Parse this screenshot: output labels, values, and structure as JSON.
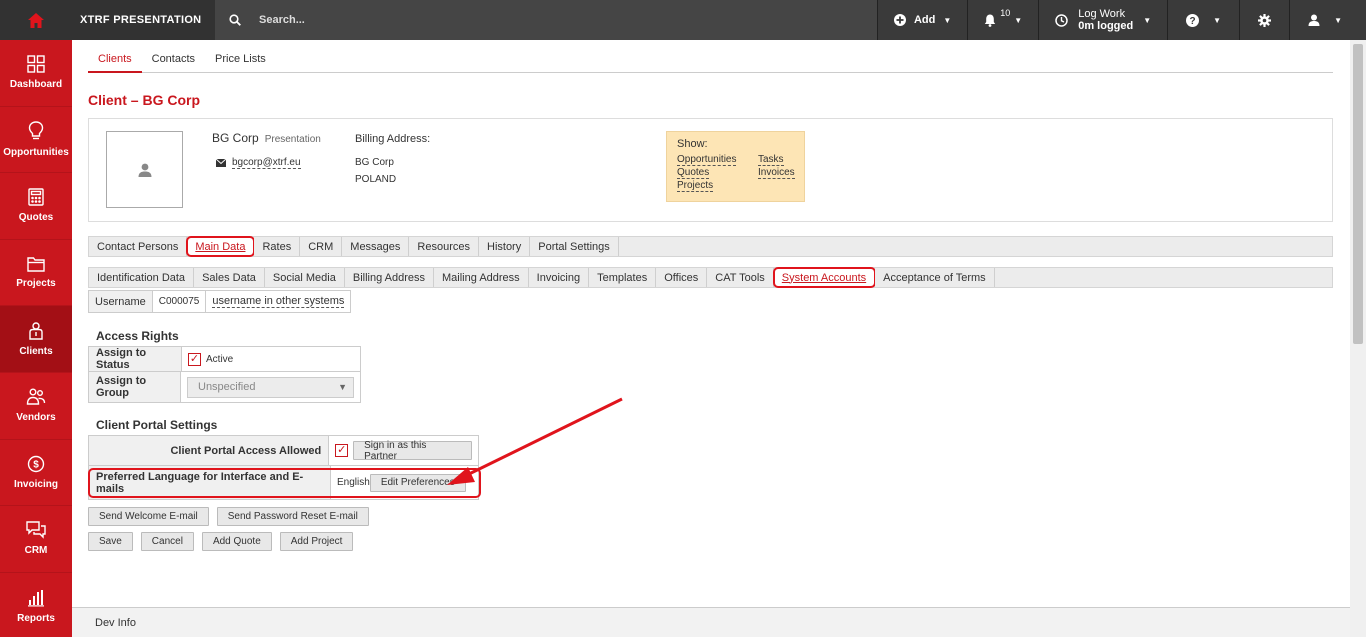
{
  "topbar": {
    "app_name": "XTRF PRESENTATION",
    "search_label": "Search...",
    "add_label": "Add",
    "notifications_count": "10",
    "logwork_line1": "Log Work",
    "logwork_line2": "0m logged"
  },
  "sidebar": {
    "items": [
      {
        "label": "Dashboard",
        "icon": "grid-icon"
      },
      {
        "label": "Opportunities",
        "icon": "lightbulb-icon"
      },
      {
        "label": "Quotes",
        "icon": "calculator-icon"
      },
      {
        "label": "Projects",
        "icon": "folder-icon"
      },
      {
        "label": "Clients",
        "icon": "client-icon"
      },
      {
        "label": "Vendors",
        "icon": "vendors-icon"
      },
      {
        "label": "Invoicing",
        "icon": "dollar-icon"
      },
      {
        "label": "CRM",
        "icon": "chat-icon"
      },
      {
        "label": "Reports",
        "icon": "bar-chart-icon"
      }
    ],
    "active": "Clients"
  },
  "tabs_top": [
    "Clients",
    "Contacts",
    "Price Lists"
  ],
  "page_title": "Client – BG Corp",
  "client": {
    "name": "BG Corp",
    "tag": "Presentation",
    "email": "bgcorp@xtrf.eu",
    "billing_heading": "Billing Address:",
    "billing_line1": "BG Corp",
    "billing_line2": "POLAND"
  },
  "show_box": {
    "heading": "Show:",
    "links": [
      "Opportunities",
      "Tasks",
      "Quotes",
      "Invoices",
      "Projects"
    ]
  },
  "tabs_main": [
    "Contact Persons",
    "Main Data",
    "Rates",
    "CRM",
    "Messages",
    "Resources",
    "History",
    "Portal Settings"
  ],
  "tabs_sub": [
    "Identification Data",
    "Sales Data",
    "Social Media",
    "Billing Address",
    "Mailing Address",
    "Invoicing",
    "Templates",
    "Offices",
    "CAT Tools",
    "System Accounts",
    "Acceptance of Terms"
  ],
  "username_row": {
    "label": "Username",
    "value": "C000075",
    "link": "username in other systems"
  },
  "access_rights": {
    "heading": "Access Rights",
    "status_label": "Assign to Status",
    "status_value": "Active",
    "group_label": "Assign to Group",
    "group_value": "Unspecified"
  },
  "portal_settings": {
    "heading": "Client Portal Settings",
    "access_label": "Client Portal Access Allowed",
    "sign_in_button": "Sign in as this Partner",
    "language_label": "Preferred Language for Interface and E-mails",
    "language_value": "English",
    "edit_prefs_button": "Edit Preferences"
  },
  "buttons": {
    "send_welcome": "Send Welcome E-mail",
    "send_reset": "Send Password Reset E-mail",
    "save": "Save",
    "cancel": "Cancel",
    "add_quote": "Add Quote",
    "add_project": "Add Project"
  },
  "dev_info": "Dev Info",
  "colors": {
    "brand_red": "#c9171e",
    "topbar": "#3a3a3a",
    "highlight": "#e0141c",
    "show_box_bg": "#fde5b5"
  }
}
